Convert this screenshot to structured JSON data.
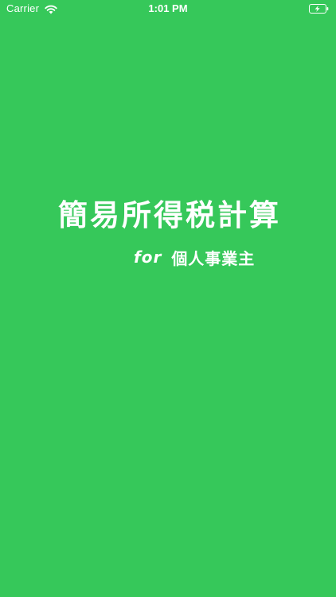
{
  "status_bar": {
    "carrier": "Carrier",
    "time": "1:01 PM",
    "wifi_icon": "wifi-icon",
    "battery_icon": "battery-charging-icon"
  },
  "splash": {
    "title": "簡易所得税計算",
    "subtitle_prefix": "for",
    "subtitle_target": "個人事業主"
  },
  "colors": {
    "background": "#36C85A",
    "text": "#FFFFFF"
  }
}
